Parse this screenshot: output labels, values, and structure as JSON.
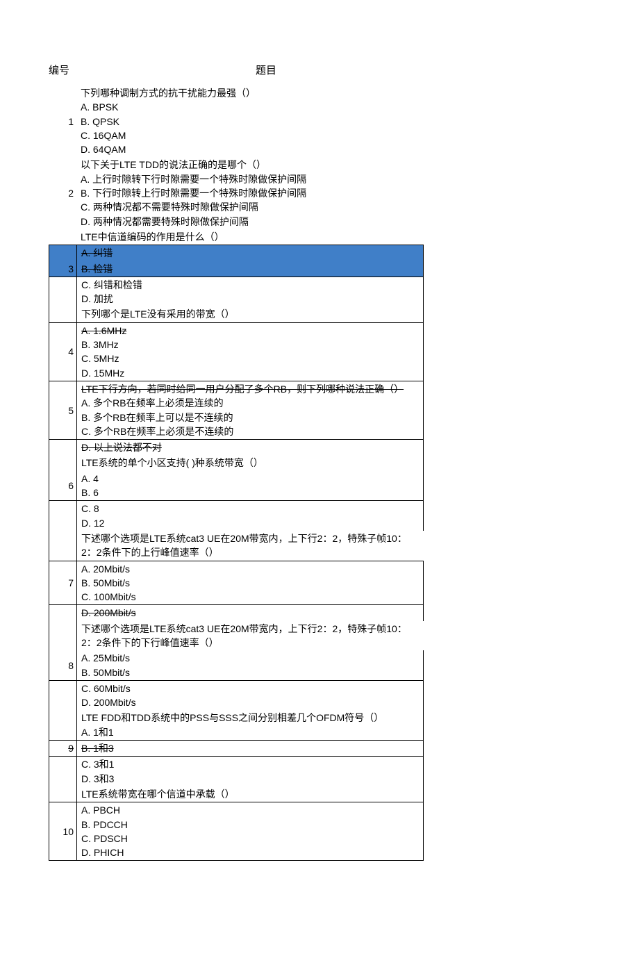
{
  "header": {
    "number": "编号",
    "question": "题目"
  },
  "rows": [
    {
      "num": "1",
      "question": "下列哪种调制方式的抗干扰能力最强（）",
      "opts": [
        "A. BPSK",
        "B. QPSK",
        "C. 16QAM",
        "D. 64QAM"
      ]
    },
    {
      "num": "2",
      "question": "以下关于LTE TDD的说法正确的是哪个（）",
      "opts": [
        "A. 上行时隙转下行时隙需要一个特殊时隙做保护间隔",
        "B. 下行时隙转上行时隙需要一个特殊时隙做保护间隔",
        "C. 两种情况都不需要特殊时隙做保护间隔",
        "D. 两种情况都需要特殊时隙做保护间隔"
      ]
    },
    {
      "num": "3",
      "question": "LTE中信道编码的作用是什么（）",
      "opts": [
        "A. 纠错",
        "B. 检错",
        "C. 纠错和检错",
        "D. 加扰"
      ]
    },
    {
      "num": "4",
      "question": "下列哪个是LTE没有采用的带宽（）",
      "opts": [
        "A. 1.6MHz",
        "B. 3MHz",
        "C. 5MHz",
        "D. 15MHz"
      ]
    },
    {
      "num": "5",
      "question": "LTE下行方向，若同时给同一用户分配了多个RB，则下列哪种说法正确（）",
      "opts": [
        "A. 多个RB在频率上必须是连续的",
        "B. 多个RB在频率上可以是不连续的",
        "C. 多个RB在频率上必须是不连续的",
        "D. 以上说法都不对"
      ]
    },
    {
      "num": "6",
      "question": "LTE系统的单个小区支持(   )种系统带宽（）",
      "opts": [
        "A. 4",
        "B. 6",
        "C. 8",
        "D. 12"
      ]
    },
    {
      "num": "7",
      "question": "下述哪个选项是LTE系统cat3 UE在20M带宽内，上下行2：2，特殊子帧10：2：2条件下的上行峰值速率（）",
      "opts": [
        "A. 20Mbit/s",
        "B. 50Mbit/s",
        "C. 100Mbit/s",
        "D. 200Mbit/s"
      ]
    },
    {
      "num": "8",
      "question": "下述哪个选项是LTE系统cat3 UE在20M带宽内，上下行2：2，特殊子帧10：2：2条件下的下行峰值速率（）",
      "opts": [
        "A. 25Mbit/s",
        "B. 50Mbit/s",
        "C. 60Mbit/s",
        "D. 200Mbit/s"
      ]
    },
    {
      "num": "9",
      "question": "LTE FDD和TDD系统中的PSS与SSS之间分别相差几个OFDM符号（）",
      "opts": [
        "A. 1和1",
        "B. 1和3",
        "C. 3和1",
        "D. 3和3"
      ]
    },
    {
      "num": "10",
      "question": "LTE系统带宽在哪个信道中承载（）",
      "opts": [
        "A. PBCH",
        "B. PDCCH",
        "C. PDSCH",
        "D. PHICH"
      ]
    }
  ]
}
